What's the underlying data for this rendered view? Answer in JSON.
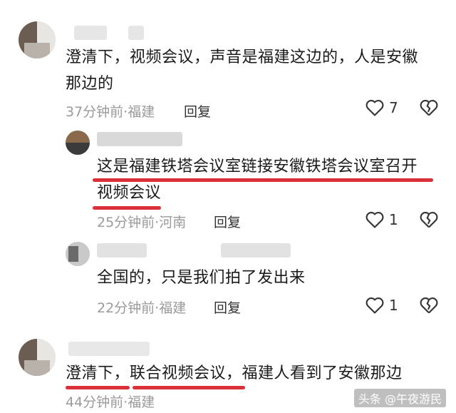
{
  "comments": [
    {
      "text_line1": "澄清下，视频会议，声音是福建这边的，人是安徽",
      "text_line2": "那边的",
      "meta": "37分钟前·福建",
      "reply_label": "回复",
      "like_count": "7"
    },
    {
      "text_line1": "这是福建铁塔会议室链接安徽铁塔会议室召开",
      "text_line2": "视频会议",
      "meta": "25分钟前·河南",
      "reply_label": "回复",
      "like_count": "1"
    },
    {
      "text_line1": "全国的，只是我们拍了发出来",
      "meta": "22分钟前·福建",
      "reply_label": "回复",
      "like_count": "1"
    },
    {
      "text_line1": "澄清下，联合视频会议，福建人看到了安徽那边",
      "meta": "44分钟前·福建"
    }
  ],
  "watermark": "头条 @午夜游民",
  "colors": {
    "accent": "#d9303a",
    "meta": "#9a9a9a"
  }
}
